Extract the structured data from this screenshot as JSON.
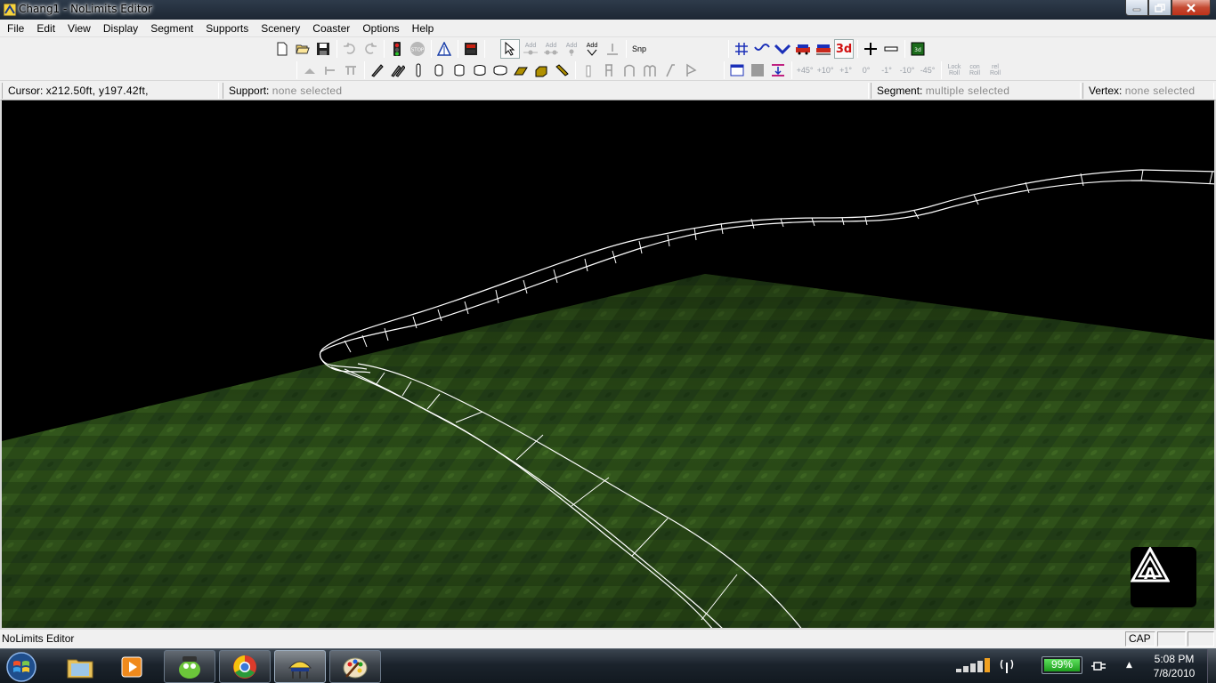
{
  "window": {
    "title": "Chang1 - NoLimits Editor"
  },
  "menu": {
    "items": [
      "File",
      "Edit",
      "View",
      "Display",
      "Segment",
      "Supports",
      "Scenery",
      "Coaster",
      "Options",
      "Help"
    ]
  },
  "toolbar": {
    "add_labels": [
      "Add",
      "Add",
      "Add",
      "Add"
    ],
    "snap_label": "Snp",
    "view_3d_label": "3d",
    "roll_labels": [
      "+45°",
      "+10°",
      "+1°",
      "0°",
      "-1°",
      "-10°",
      "-45°"
    ],
    "lock_roll_label": [
      "Lock",
      "Roll"
    ],
    "con_roll_label": [
      "con",
      "Roll"
    ],
    "rel_roll_label": [
      "rel",
      "Roll"
    ]
  },
  "infobar": {
    "cursor_label": "Cursor:",
    "cursor_value": "x212.50ft, y197.42ft,",
    "support_label": "Support:",
    "support_value": "none selected",
    "segment_label": "Segment:",
    "segment_value": "multiple selected",
    "vertex_label": "Vertex:",
    "vertex_value": "none selected"
  },
  "statusbar": {
    "text": "NoLimits Editor",
    "cap": "CAP"
  },
  "taskbar": {
    "battery_percent": "99%",
    "battery_level": 0.99,
    "time": "5:08 PM",
    "date": "7/8/2010"
  },
  "colors": {
    "ground_dark": "#1f3a12",
    "ground_light": "#3d6a22",
    "track": "#ffffff",
    "sky": "#000000"
  }
}
